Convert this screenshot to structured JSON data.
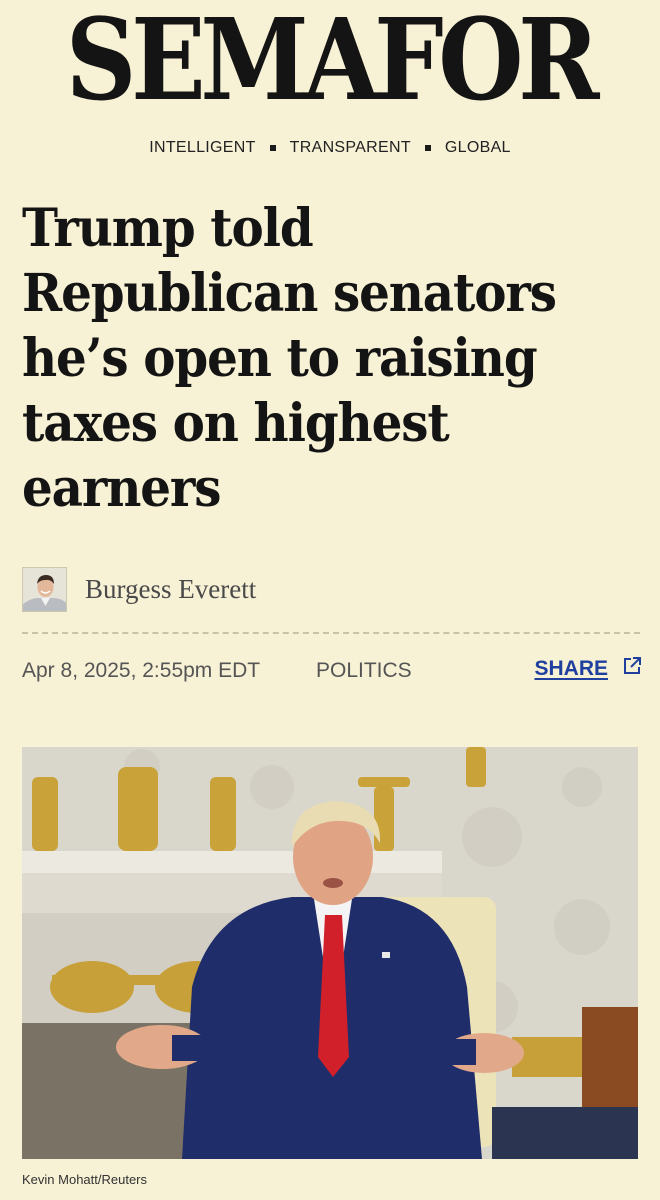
{
  "masthead": {
    "logo": "SEMAFOR",
    "tagline": [
      "INTELLIGENT",
      "TRANSPARENT",
      "GLOBAL"
    ]
  },
  "article": {
    "headline_lines": [
      "Trump told",
      "Republican senators",
      "he’s open to raising",
      "taxes on highest",
      "earners"
    ],
    "author": "Burgess Everett",
    "date": "Apr 8, 2025, 2:55pm EDT",
    "section": "POLITICS",
    "share_label": "SHARE",
    "photo_credit": "Kevin Mohatt/Reuters"
  },
  "colors": {
    "background": "#f7f1d5",
    "link": "#2040a0",
    "text": "#141414"
  },
  "icons": {
    "share": "external-link-icon"
  }
}
